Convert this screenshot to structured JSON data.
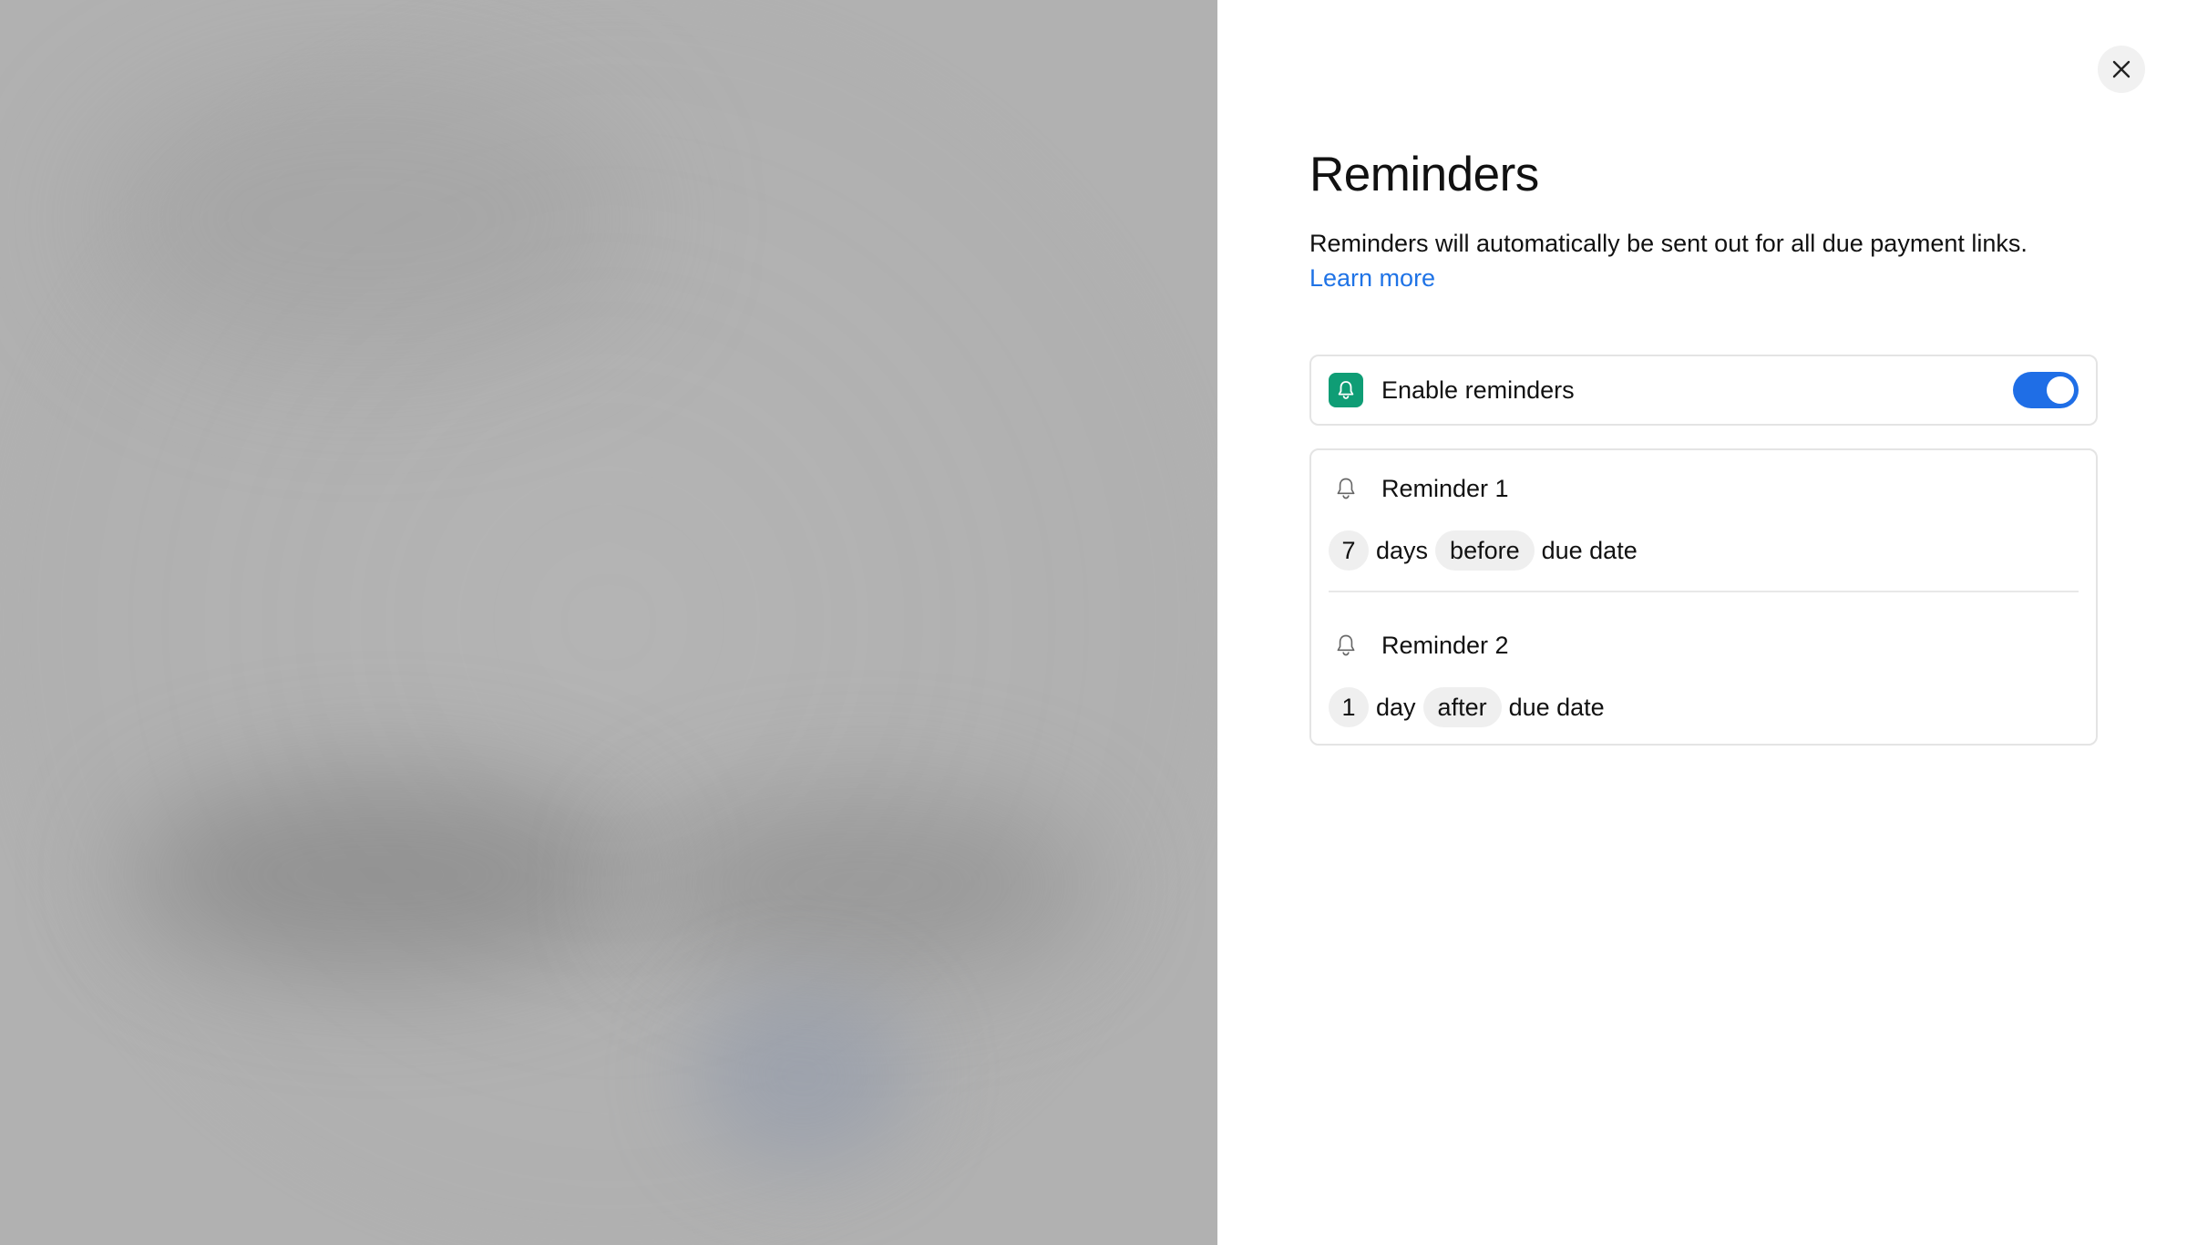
{
  "panel": {
    "title": "Reminders",
    "description": "Reminders will automatically be sent out for all due payment links.",
    "learn_more": "Learn more"
  },
  "enable": {
    "label": "Enable reminders",
    "enabled": true,
    "icon": "bell-icon"
  },
  "reminders": [
    {
      "title": "Reminder 1",
      "amount": "7",
      "unit": "days",
      "relation": "before",
      "suffix": "due date"
    },
    {
      "title": "Reminder 2",
      "amount": "1",
      "unit": "day",
      "relation": "after",
      "suffix": "due date"
    }
  ],
  "colors": {
    "accent_blue": "#1f6ee6",
    "link_blue": "#1f73e6",
    "bell_badge_green": "#0f9d75",
    "backdrop_gray": "#b1b1b1"
  },
  "icons": {
    "close": "close-icon",
    "bell": "bell-icon"
  }
}
